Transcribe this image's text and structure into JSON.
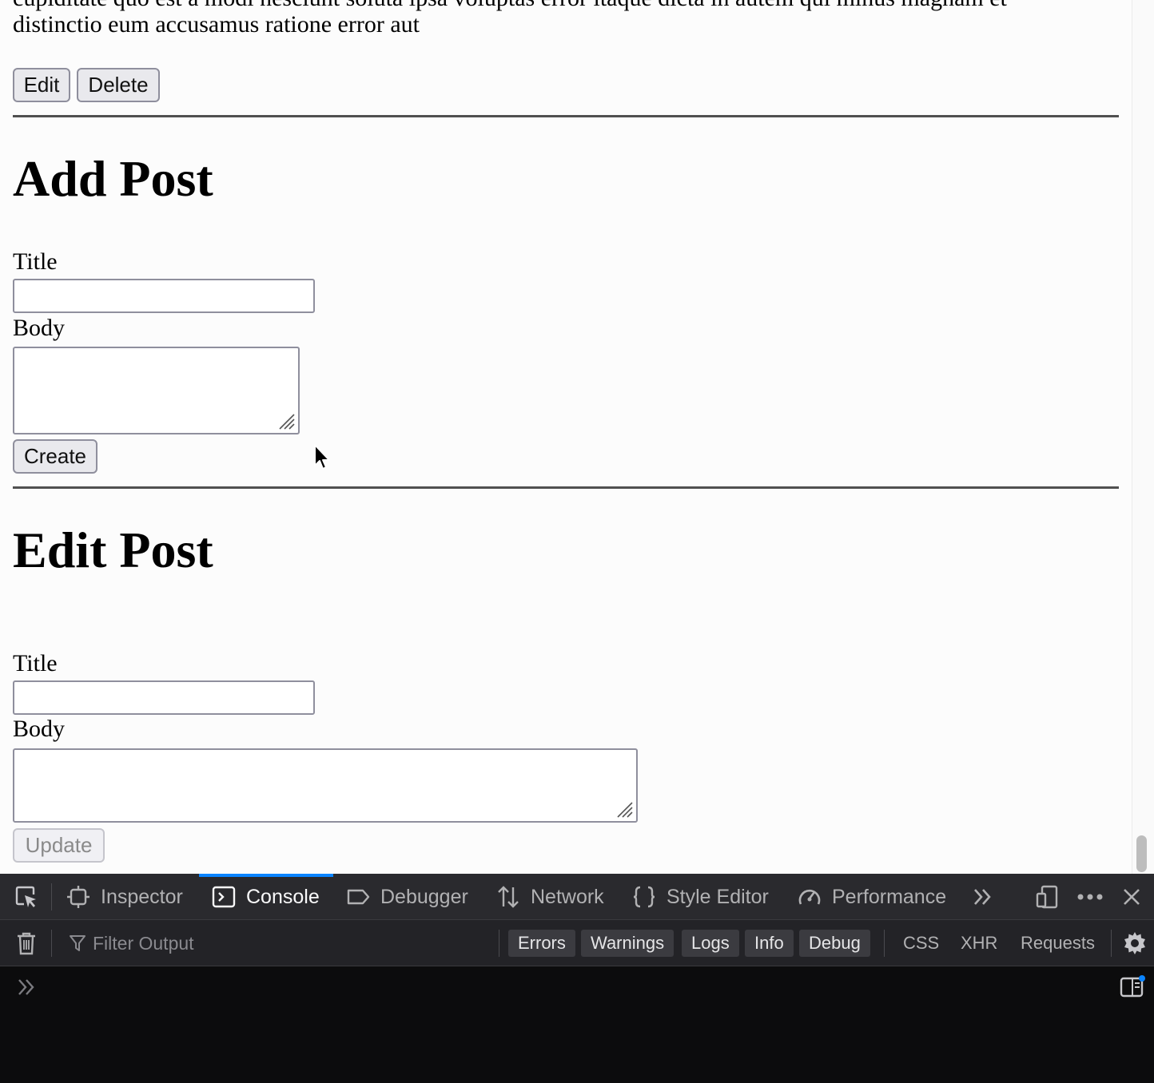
{
  "page": {
    "top_text_partial": "cupiditate quo est a modi nesciunt soluta ipsa voluptas error itaque dicta in autem qui minus magnam et",
    "top_text_line2": "distinctio eum accusamus ratione error aut",
    "edit_label": "Edit",
    "delete_label": "Delete",
    "add_post": {
      "heading": "Add Post",
      "title_label": "Title",
      "title_value": "",
      "body_label": "Body",
      "body_value": "",
      "create_label": "Create"
    },
    "edit_post": {
      "heading": "Edit Post",
      "title_label": "Title",
      "title_value": "",
      "body_label": "Body",
      "body_value": "",
      "update_label": "Update"
    }
  },
  "devtools": {
    "tabs": [
      {
        "label": "Inspector",
        "icon": "inspector-icon"
      },
      {
        "label": "Console",
        "icon": "console-icon",
        "active": true
      },
      {
        "label": "Debugger",
        "icon": "debugger-icon"
      },
      {
        "label": "Network",
        "icon": "network-icon"
      },
      {
        "label": "Style Editor",
        "icon": "style-editor-icon"
      },
      {
        "label": "Performance",
        "icon": "performance-icon"
      }
    ],
    "filter_placeholder": "Filter Output",
    "levels": [
      "Errors",
      "Warnings",
      "Logs",
      "Info",
      "Debug"
    ],
    "categories": [
      "CSS",
      "XHR",
      "Requests"
    ],
    "accent_color": "#0a84ff"
  }
}
